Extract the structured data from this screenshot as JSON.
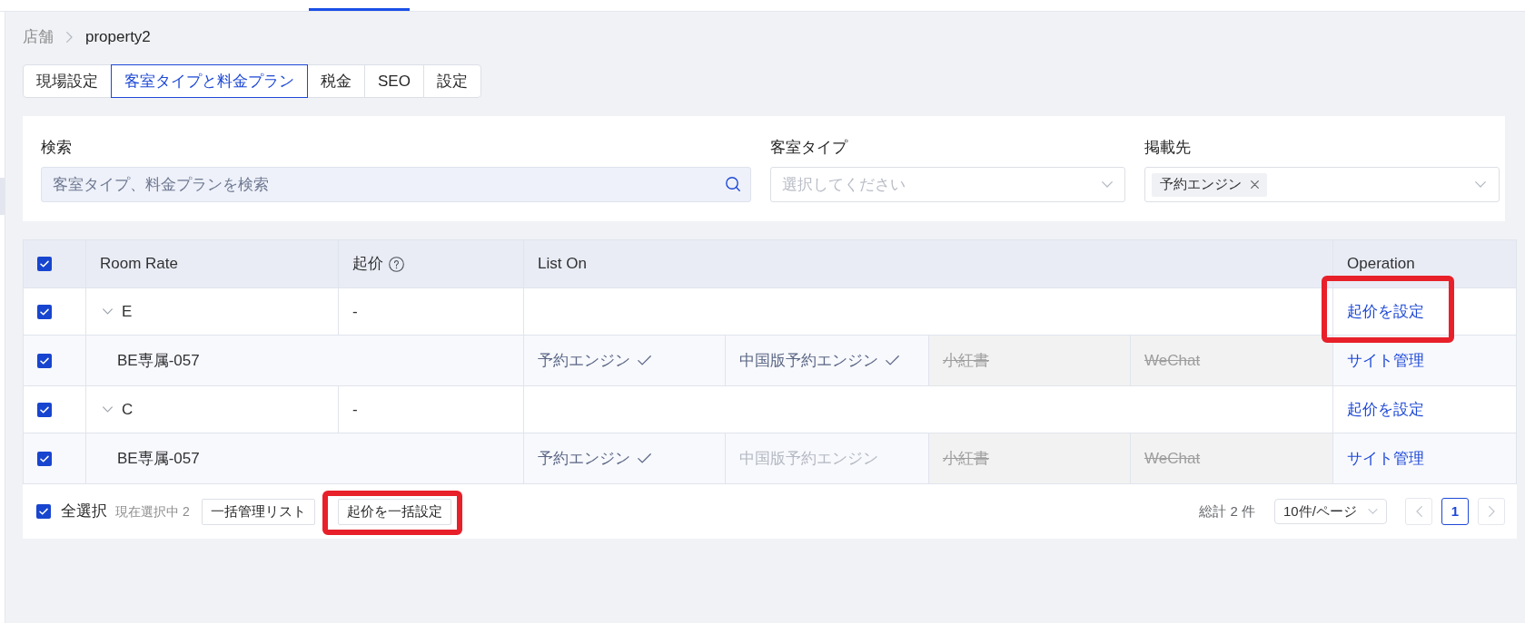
{
  "breadcrumb": [
    {
      "label": "店舗",
      "current": false
    },
    {
      "label": "property2",
      "current": true
    }
  ],
  "tabs": [
    {
      "label": "現場設定",
      "selected": false
    },
    {
      "label": "客室タイプと料金プラン",
      "selected": true
    },
    {
      "label": "税金",
      "selected": false
    },
    {
      "label": "SEO",
      "selected": false
    },
    {
      "label": "設定",
      "selected": false
    }
  ],
  "filters": {
    "search": {
      "label": "検索",
      "placeholder": "客室タイプ、料金プランを検索"
    },
    "room_type": {
      "label": "客室タイプ",
      "placeholder": "選択してください"
    },
    "listed_on": {
      "label": "掲載先",
      "tags": [
        "予約エンジン"
      ]
    }
  },
  "table": {
    "header_checked": true,
    "columns": [
      {
        "label": "Room Rate",
        "help": false
      },
      {
        "label": "起价",
        "help": true
      },
      {
        "label": "List On",
        "help": false
      },
      {
        "label": "Operation",
        "help": false
      }
    ],
    "rows": [
      {
        "kind": "room",
        "checked": true,
        "expanded": true,
        "name": "E",
        "starting_price": "-",
        "operation": {
          "label": "起价を設定",
          "highlighted": true
        }
      },
      {
        "kind": "rate",
        "checked": true,
        "name": "BE専属-057",
        "channels": [
          {
            "label": "予約エンジン",
            "listed": true,
            "disabled": false
          },
          {
            "label": "中国版予約エンジン",
            "listed": true,
            "disabled": false
          },
          {
            "label": "小紅書",
            "listed": false,
            "disabled": true
          },
          {
            "label": "WeChat",
            "listed": false,
            "disabled": true
          }
        ],
        "operation": {
          "label": "サイト管理",
          "highlighted": false
        }
      },
      {
        "kind": "room",
        "checked": true,
        "expanded": true,
        "name": "C",
        "starting_price": "-",
        "operation": {
          "label": "起价を設定",
          "highlighted": false
        }
      },
      {
        "kind": "rate",
        "checked": true,
        "name": "BE専属-057",
        "channels": [
          {
            "label": "予約エンジン",
            "listed": true,
            "disabled": false
          },
          {
            "label": "中国版予約エンジン",
            "listed": false,
            "disabled": false
          },
          {
            "label": "小紅書",
            "listed": false,
            "disabled": true
          },
          {
            "label": "WeChat",
            "listed": false,
            "disabled": true
          }
        ],
        "operation": {
          "label": "サイト管理",
          "highlighted": false
        }
      }
    ]
  },
  "footer": {
    "select_all": {
      "label": "全選択",
      "checked": true
    },
    "selection_count": "現在選択中 2",
    "buttons": [
      {
        "label": "一括管理リスト",
        "highlighted": false
      },
      {
        "label": "起价を一括設定",
        "highlighted": true
      }
    ],
    "total": "総計 2 件",
    "page_size": "10件/ページ",
    "pages": [
      {
        "label": "1",
        "selected": true
      }
    ]
  }
}
